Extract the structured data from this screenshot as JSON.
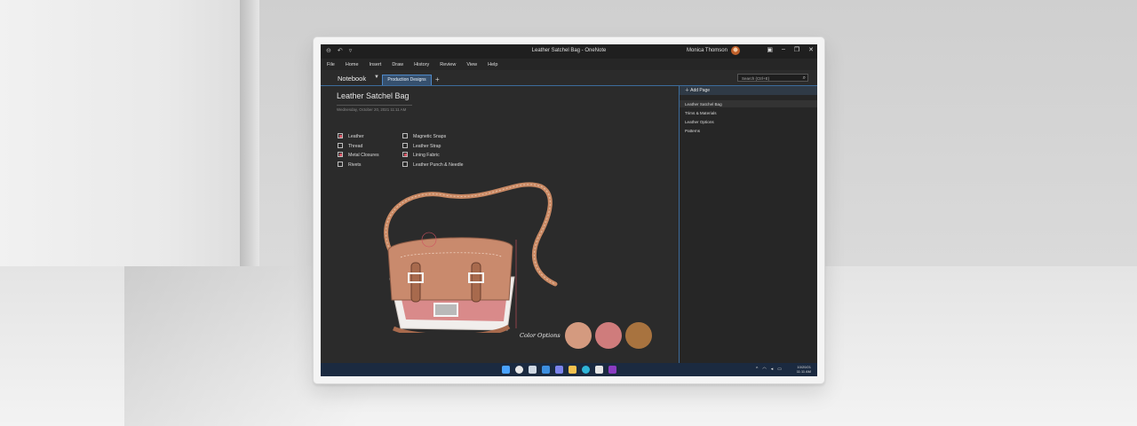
{
  "window": {
    "title": "Leather Satchel Bag - OneNote",
    "user_name": "Monica Thomson",
    "controls": [
      "▣",
      "–",
      "❐",
      "✕"
    ]
  },
  "menu": [
    "File",
    "Home",
    "Insert",
    "Draw",
    "History",
    "Review",
    "View",
    "Help"
  ],
  "notebook": {
    "name": "Notebook",
    "section_tab": "Production Designs",
    "add_tab": "+",
    "search_placeholder": "Search (Ctrl+E)"
  },
  "page": {
    "title": "Leather Satchel Bag",
    "date": "Wednesday, October 20, 2021    11:11 AM",
    "checklist_left": [
      {
        "label": "Leather",
        "checked": true
      },
      {
        "label": "Thread",
        "checked": false
      },
      {
        "label": "Metal Closures",
        "checked": true
      },
      {
        "label": "Rivets",
        "checked": false
      }
    ],
    "checklist_right": [
      {
        "label": "Magnetic Snaps",
        "checked": false
      },
      {
        "label": "Leather Strap",
        "checked": false
      },
      {
        "label": "Lining Fabric",
        "checked": true
      },
      {
        "label": "Leather Punch & Needle",
        "checked": false
      }
    ],
    "color_options_label": "Color Options",
    "color_swatches": [
      "#d49a7f",
      "#cf7c7c",
      "#a8733f"
    ]
  },
  "pages_pane": {
    "add_page": "Add Page",
    "items": [
      "Leather Satchel Bag",
      "Trims & Materials",
      "Leather Options",
      "Patterns"
    ]
  },
  "taskbar": {
    "icons": [
      {
        "name": "start-icon",
        "color": "#4aa3ff"
      },
      {
        "name": "search-icon",
        "color": "#e8e8e8"
      },
      {
        "name": "task-view-icon",
        "color": "#cfd8e3"
      },
      {
        "name": "widgets-icon",
        "color": "#3d8fe0"
      },
      {
        "name": "teams-icon",
        "color": "#7b83eb"
      },
      {
        "name": "explorer-icon",
        "color": "#f2c14e"
      },
      {
        "name": "edge-icon",
        "color": "#2fb5d8"
      },
      {
        "name": "store-icon",
        "color": "#e6e6e6"
      },
      {
        "name": "onenote-icon",
        "color": "#8b3cc1"
      }
    ],
    "date": "10/20/21",
    "time": "11:11 AM"
  }
}
